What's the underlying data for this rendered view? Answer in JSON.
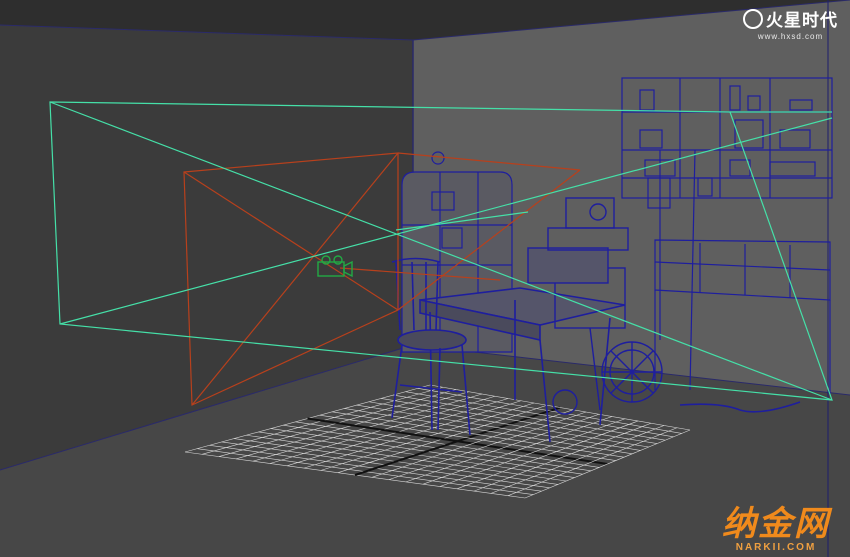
{
  "viewport": {
    "label": "3D viewport (wireframe on shaded)"
  },
  "watermarks": {
    "top_brand": "火星时代",
    "top_url": "www.hxsd.com",
    "bottom_brand": "纳金网",
    "bottom_url": "NARKII.COM"
  },
  "colors": {
    "background": "#2f2f2f",
    "back_wall": "#5f5f5f",
    "left_wall": "#3b3b3b",
    "floor": "#4a4a4a",
    "wireframe": "#1e1e9e",
    "camera_frustum": "#45e0a8",
    "light_frustum": "#b8401c",
    "grid": "#d8d8d8",
    "brand_orange": "#f08a1c"
  }
}
